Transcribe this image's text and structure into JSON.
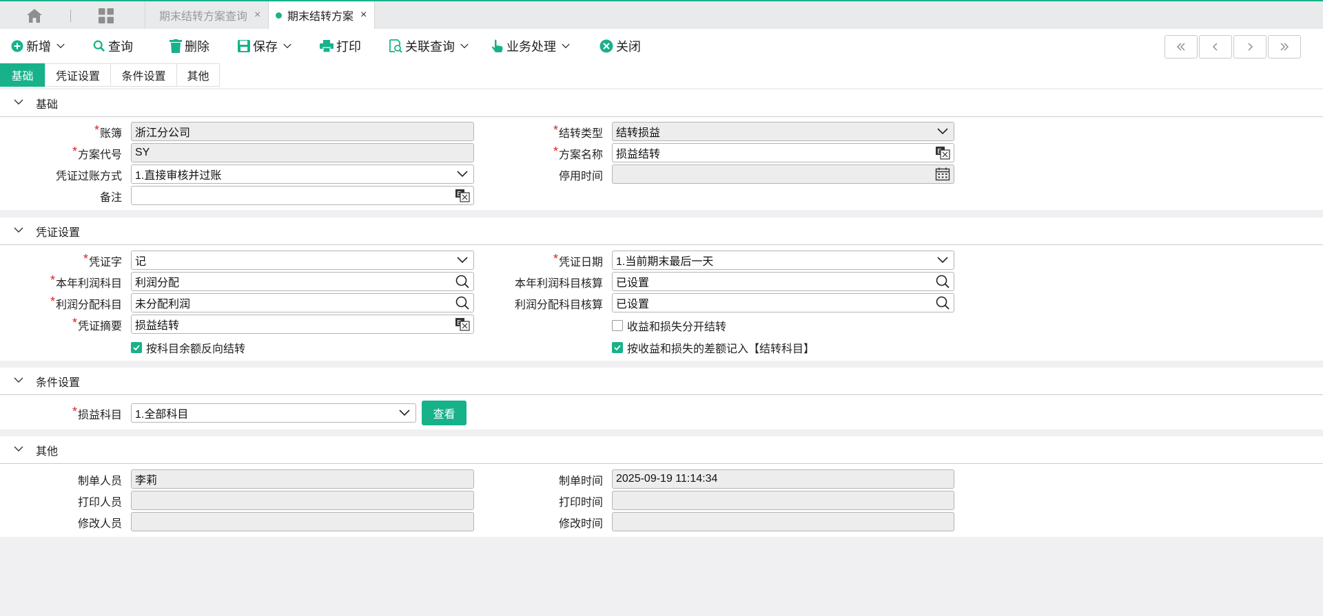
{
  "tabs": {
    "home_icon": "home-icon",
    "apps_icon": "grid-icon",
    "items": [
      {
        "label": "期末结转方案查询"
      },
      {
        "label": "期末结转方案"
      }
    ],
    "close_glyph": "×"
  },
  "toolbar": {
    "add": "新增",
    "query": "查询",
    "delete": "删除",
    "save": "保存",
    "print": "打印",
    "related": "关联查询",
    "business": "业务处理",
    "close": "关闭"
  },
  "section_tabs": [
    "基础",
    "凭证设置",
    "条件设置",
    "其他"
  ],
  "basic": {
    "title": "基础",
    "book_label": "账簿",
    "book_value": "浙江分公司",
    "carry_type_label": "结转类型",
    "carry_type_value": "结转损益",
    "plan_code_label": "方案代号",
    "plan_code_value": "SY",
    "plan_name_label": "方案名称",
    "plan_name_value": "损益结转",
    "posting_label": "凭证过账方式",
    "posting_value": "1.直接审核并过账",
    "disable_time_label": "停用时间",
    "disable_time_value": "",
    "remark_label": "备注",
    "remark_value": ""
  },
  "voucher": {
    "title": "凭证设置",
    "word_label": "凭证字",
    "word_value": "记",
    "date_label": "凭证日期",
    "date_value": "1.当前期末最后一天",
    "profit_label": "本年利润科目",
    "profit_value": "利润分配",
    "profit_acct_label": "本年利润科目核算",
    "profit_acct_value": "已设置",
    "dist_label": "利润分配科目",
    "dist_value": "未分配利润",
    "dist_acct_label": "利润分配科目核算",
    "dist_acct_value": "已设置",
    "summary_label": "凭证摘要",
    "summary_value": "损益结转",
    "separate_label": "收益和损失分开结转",
    "separate_checked": false,
    "reverse_label": "按科目余额反向结转",
    "reverse_checked": true,
    "diff_label": "按收益和损失的差额记入【结转科目】",
    "diff_checked": true
  },
  "condition": {
    "title": "条件设置",
    "subject_label": "损益科目",
    "subject_value": "1.全部科目",
    "view_button": "查看"
  },
  "other": {
    "title": "其他",
    "creator_label": "制单人员",
    "creator_value": "李莉",
    "create_time_label": "制单时间",
    "create_time_value": "2025-09-19 11:14:34",
    "printer_label": "打印人员",
    "printer_value": "",
    "print_time_label": "打印时间",
    "print_time_value": "",
    "modifier_label": "修改人员",
    "modifier_value": "",
    "modify_time_label": "修改时间",
    "modify_time_value": ""
  },
  "colors": {
    "accent": "#17b28a",
    "required": "#e02020"
  }
}
